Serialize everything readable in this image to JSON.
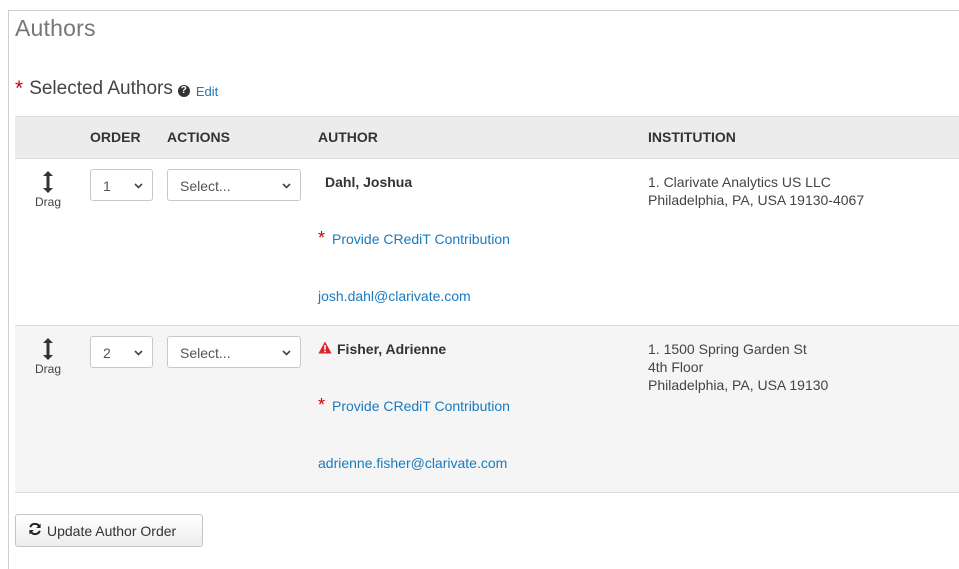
{
  "page": {
    "title": "Authors"
  },
  "section": {
    "label": "Selected Authors",
    "required_mark": "*",
    "edit_label": "Edit"
  },
  "table": {
    "headers": {
      "order": "ORDER",
      "actions": "ACTIONS",
      "author": "AUTHOR",
      "institution": "INSTITUTION"
    },
    "rows": [
      {
        "drag_label": "Drag",
        "order": "1",
        "action": "Select...",
        "name": "Dahl, Joshua",
        "warning": false,
        "credit_mark": "*",
        "credit_label": "Provide CRediT Contribution",
        "email": "josh.dahl@clarivate.com",
        "institution": [
          "1. Clarivate Analytics US LLC",
          "Philadelphia, PA, USA 19130-4067"
        ]
      },
      {
        "drag_label": "Drag",
        "order": "2",
        "action": "Select...",
        "name": "Fisher, Adrienne",
        "warning": true,
        "credit_mark": "*",
        "credit_label": "Provide CRediT Contribution",
        "email": "adrienne.fisher@clarivate.com",
        "institution": [
          "1. 1500 Spring Garden St",
          "4th Floor",
          "Philadelphia, PA, USA 19130"
        ]
      }
    ]
  },
  "update_button": {
    "label": "Update Author Order"
  },
  "icons": {
    "drag": "vertical-arrows-icon",
    "help": "question-circle-icon",
    "warning": "warning-triangle-icon",
    "refresh": "refresh-icon"
  },
  "colors": {
    "link": "#1a7abf",
    "required": "#cc0000",
    "header_bg": "#ececec"
  }
}
